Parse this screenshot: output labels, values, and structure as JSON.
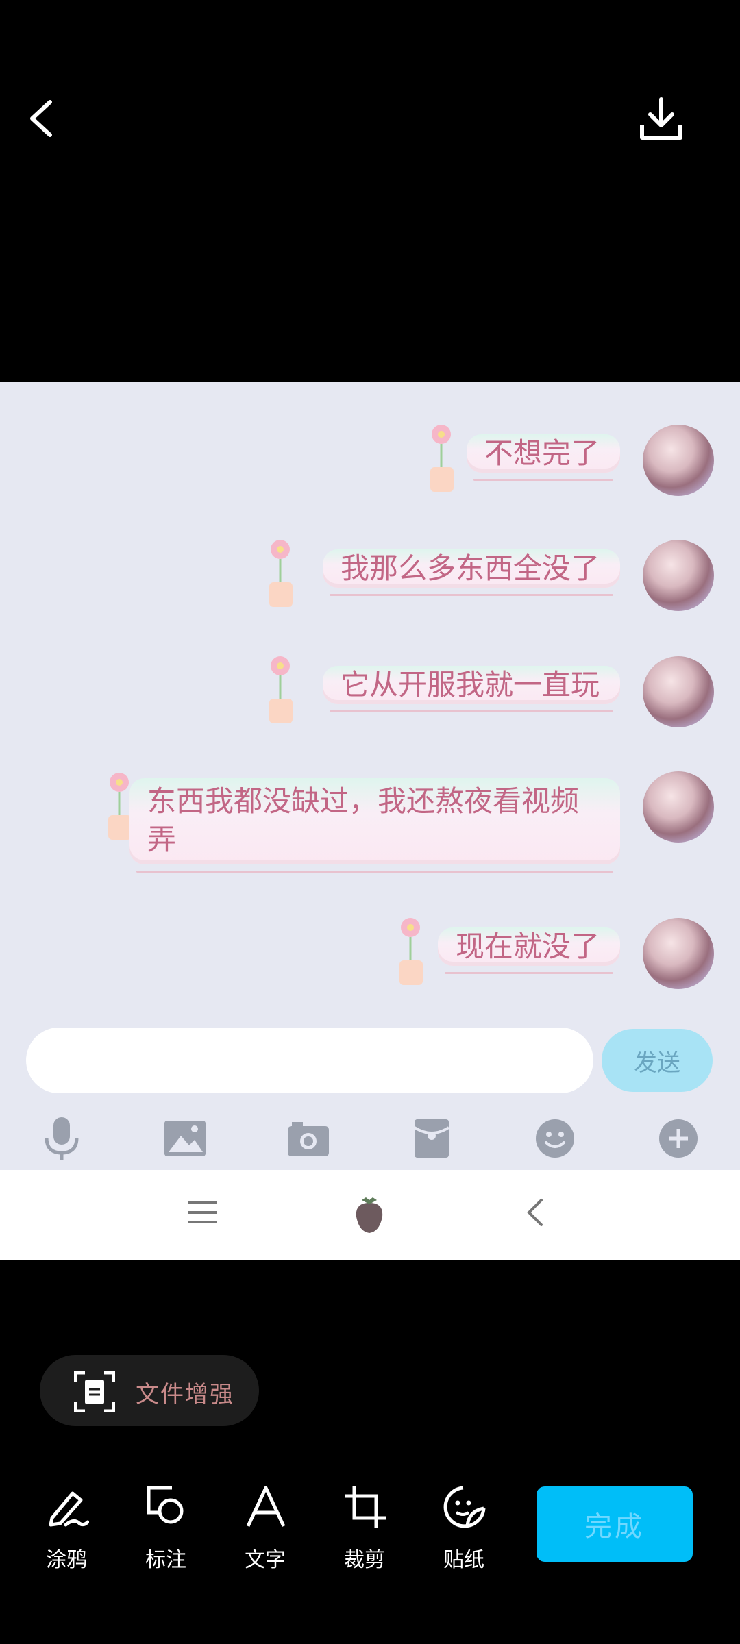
{
  "top_bar": {
    "back_icon": "chevron-left-icon",
    "download_icon": "download-icon"
  },
  "chat": {
    "messages": [
      {
        "text": "不想完了"
      },
      {
        "text": "我那么多东西全没了"
      },
      {
        "text": "它从开服我就一直玩"
      },
      {
        "text": "东西我都没缺过，我还熬夜看视频弄"
      },
      {
        "text": "现在就没了"
      }
    ],
    "input_value": "",
    "send_label": "发送",
    "toolbar_icons": [
      "microphone-icon",
      "image-icon",
      "camera-icon",
      "red-packet-icon",
      "emoji-icon",
      "plus-icon"
    ]
  },
  "system_nav": {
    "menu_icon": "menu-icon",
    "home_icon": "strawberry-icon",
    "back_icon": "back-icon"
  },
  "enhance": {
    "label": "文件增强",
    "icon": "document-scan-icon"
  },
  "editor_tools": [
    {
      "label": "涂鸦",
      "icon": "pen-icon"
    },
    {
      "label": "标注",
      "icon": "annotate-icon"
    },
    {
      "label": "文字",
      "icon": "text-icon"
    },
    {
      "label": "裁剪",
      "icon": "crop-icon"
    },
    {
      "label": "贴纸",
      "icon": "sticker-icon"
    }
  ],
  "done_label": "完成",
  "colors": {
    "accent": "#00bef8",
    "bubble_text": "#c26685",
    "chat_bg": "#e6e8f2"
  }
}
